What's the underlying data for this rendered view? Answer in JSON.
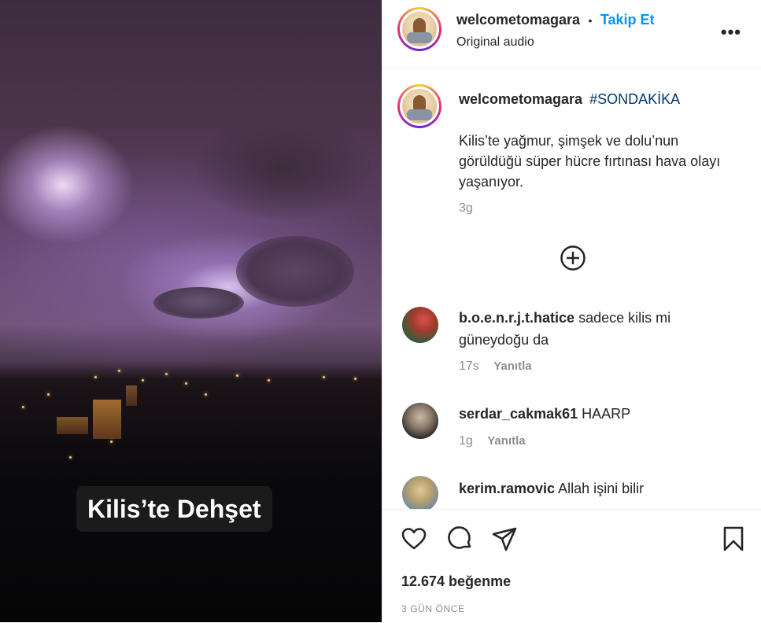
{
  "post": {
    "username": "welcometomagara",
    "separator": "•",
    "follow_label": "Takip Et",
    "audio": "Original audio",
    "more_label": "•••"
  },
  "media": {
    "overlay_caption": "Kilis’te Dehşet"
  },
  "caption": {
    "username": "welcometomagara",
    "hashtag": "#SONDAKİKA",
    "text": "Kilis’te yağmur, şimşek ve dolu’nun görüldüğü süper hücre fırtınası hava olayı yaşanıyor.",
    "time": "3g"
  },
  "comments": [
    {
      "username": "b.o.e.n.r.j.t.hatice",
      "text": "sadece kilis mi güneydoğu da",
      "time": "17s",
      "reply": "Yanıtla"
    },
    {
      "username": "serdar_cakmak61",
      "text": "HAARP",
      "time": "1g",
      "reply": "Yanıtla"
    },
    {
      "username": "kerim.ramovic",
      "text": "Allah işini bilir",
      "time": "",
      "reply": ""
    }
  ],
  "stats": {
    "likes": "12.674 beğenme",
    "date": "3 GÜN ÖNCE"
  },
  "colors": {
    "accent_blue": "#0095f6",
    "hashtag": "#00376b",
    "muted": "#8e8e8e",
    "text": "#262626"
  }
}
